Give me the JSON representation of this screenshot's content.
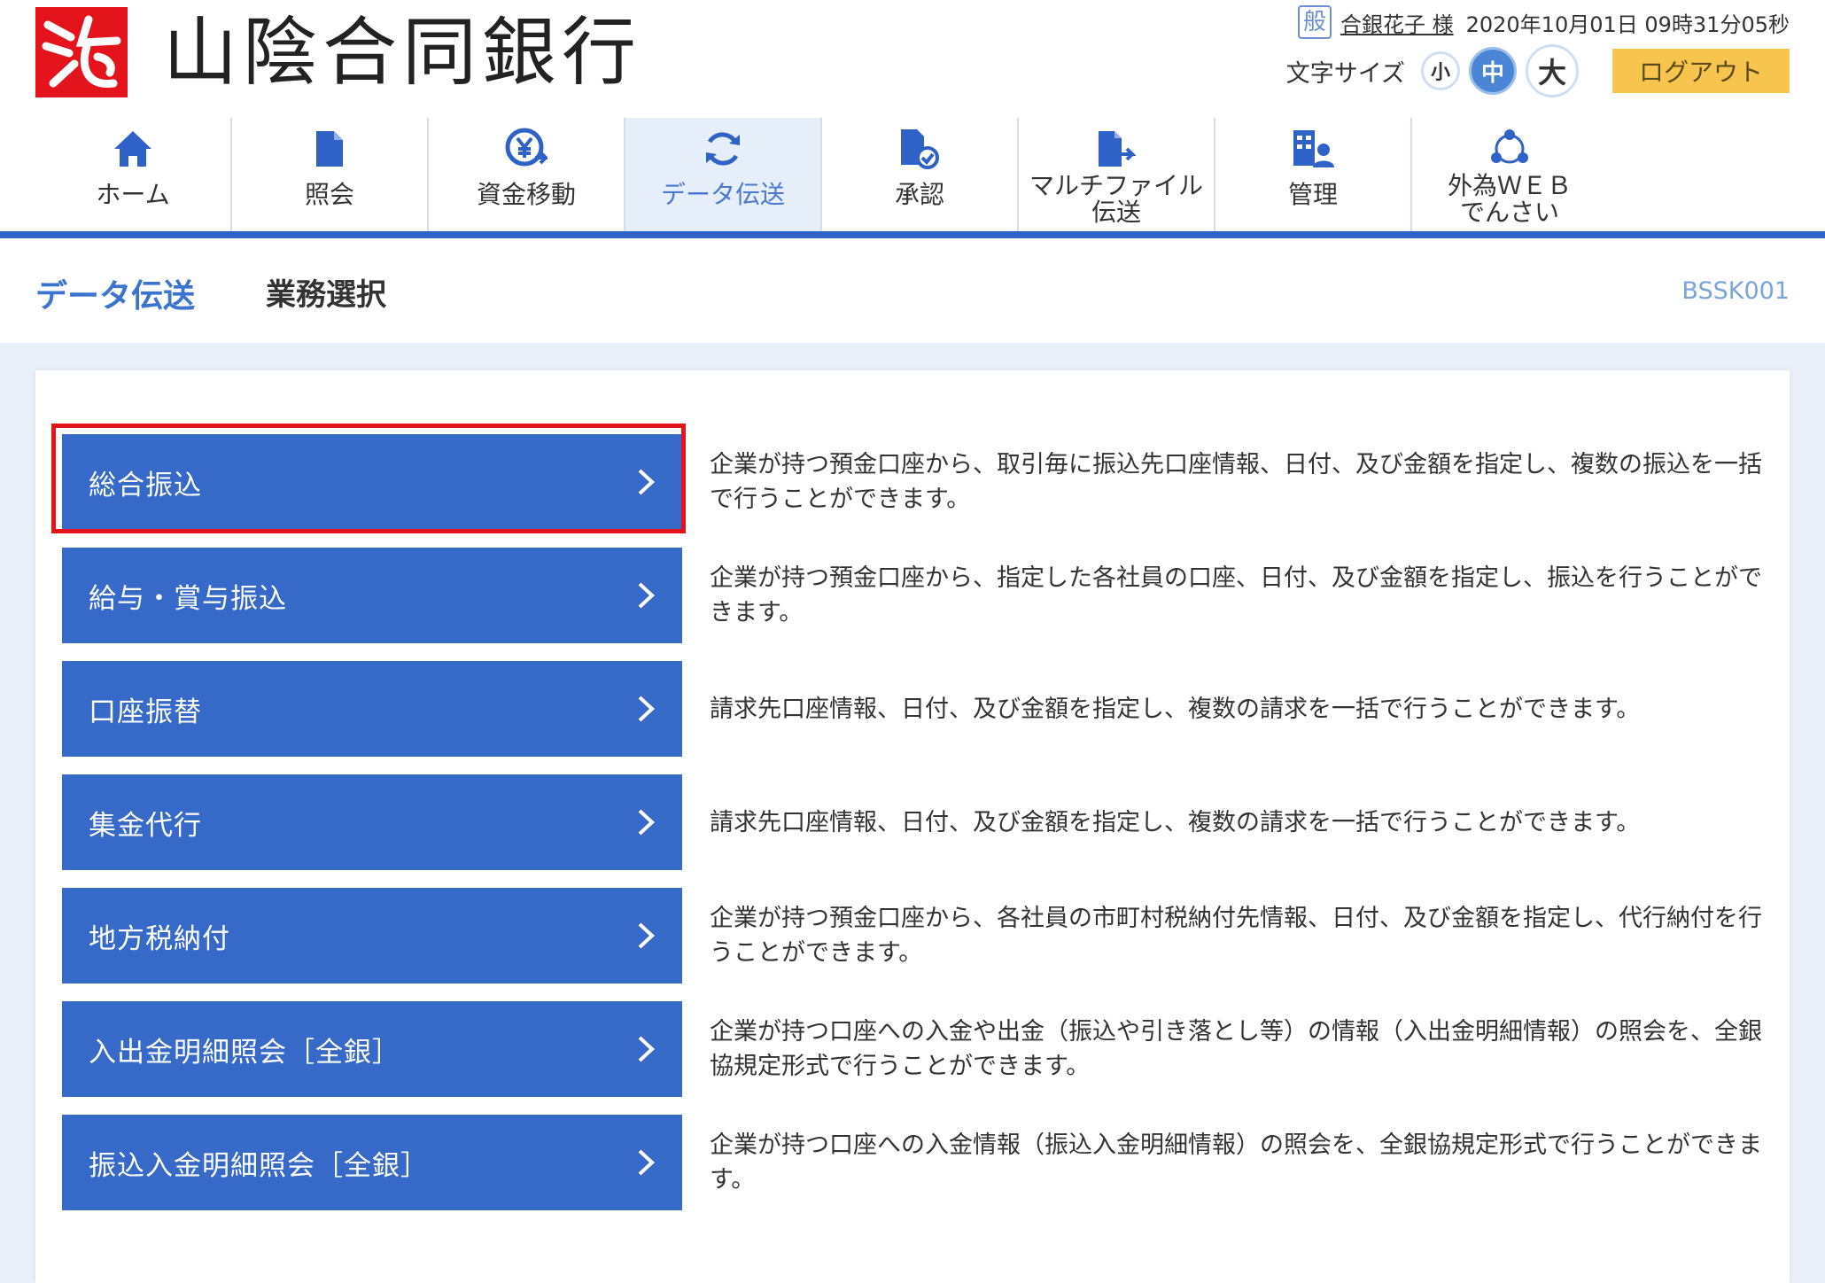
{
  "header": {
    "bank_name": "山陰合同銀行",
    "user_badge": "般",
    "user_name": "合銀花子 様",
    "datetime": "2020年10月01日 09時31分05秒",
    "font_size_label": "文字サイズ",
    "font_small": "小",
    "font_medium": "中",
    "font_large": "大",
    "logout_label": "ログアウト"
  },
  "nav": {
    "items": [
      {
        "label": "ホーム",
        "icon": "home-icon"
      },
      {
        "label": "照会",
        "icon": "document-icon"
      },
      {
        "label": "資金移動",
        "icon": "yen-transfer-icon"
      },
      {
        "label": "データ伝送",
        "icon": "refresh-icon"
      },
      {
        "label": "承認",
        "icon": "approve-icon"
      },
      {
        "label_line1": "マルチファイル",
        "label_line2": "伝送",
        "icon": "multi-file-icon"
      },
      {
        "label": "管理",
        "icon": "manage-icon"
      },
      {
        "label_line1": "外為ＷＥＢ",
        "label_line2": "でんさい",
        "icon": "network-icon"
      }
    ],
    "active_index": 3
  },
  "title": {
    "main": "データ伝送",
    "sub": "業務選択",
    "screen_code": "BSSK001"
  },
  "menu": [
    {
      "label": "総合振込",
      "desc": "企業が持つ預金口座から、取引毎に振込先口座情報、日付、及び金額を指定し、複数の振込を一括で行うことができます。"
    },
    {
      "label": "給与・賞与振込",
      "desc": "企業が持つ預金口座から、指定した各社員の口座、日付、及び金額を指定し、振込を行うことができます。"
    },
    {
      "label": "口座振替",
      "desc": "請求先口座情報、日付、及び金額を指定し、複数の請求を一括で行うことができます。"
    },
    {
      "label": "集金代行",
      "desc": "請求先口座情報、日付、及び金額を指定し、複数の請求を一括で行うことができます。"
    },
    {
      "label": "地方税納付",
      "desc": "企業が持つ預金口座から、各社員の市町村税納付先情報、日付、及び金額を指定し、代行納付を行うことができます。"
    },
    {
      "label": "入出金明細照会［全銀］",
      "desc": "企業が持つ口座への入金や出金（振込や引き落とし等）の情報（入出金明細情報）の照会を、全銀協規定形式で行うことができます。"
    },
    {
      "label": "振込入金明細照会［全銀］",
      "desc": "企業が持つ口座への入金情報（振込入金明細情報）の照会を、全銀協規定形式で行うことができます。"
    }
  ],
  "colors": {
    "primary": "#3769c9",
    "nav_border": "#2f62c7",
    "highlight": "#e3141c",
    "logout": "#f7c44e",
    "logo_red": "#e3141c"
  }
}
